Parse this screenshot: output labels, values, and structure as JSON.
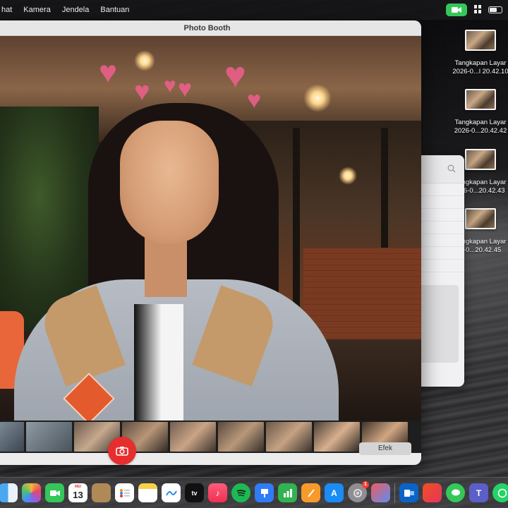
{
  "menubar": {
    "items": [
      "hat",
      "Kamera",
      "Jendela",
      "Bantuan"
    ]
  },
  "window": {
    "title": "Photo Booth"
  },
  "toolbar": {
    "effects_label": "Efek"
  },
  "desktop": {
    "files": [
      {
        "name_line1": "Tangkapan Layar",
        "name_line2": "2026-0...l 20.42.10"
      },
      {
        "name_line1": "Tangkapan Layar",
        "name_line2": "2026-0...20.42.42"
      },
      {
        "name_line1": "Tangkapan Layar",
        "name_line2": "026-0...20.42.43"
      },
      {
        "name_line1": "Tangkapan Layar",
        "name_line2": "6-0...20.42.45"
      }
    ]
  },
  "dock": {
    "calendar_month": "MEI",
    "calendar_day": "13",
    "settings_badge": "1",
    "apps": [
      "finder-icon",
      "photos-icon",
      "facetime-icon",
      "calendar-icon",
      "contacts-icon",
      "reminders-icon",
      "notes-icon",
      "freeform-icon",
      "appletv-icon",
      "music-icon",
      "spotify-icon",
      "keynote-icon",
      "numbers-icon",
      "pages-icon",
      "appstore-icon",
      "system-settings-icon",
      "iphone-mirroring-icon",
      "outlook-icon",
      "office-icon",
      "messages-icon",
      "teams-icon",
      "whatsapp-icon"
    ]
  },
  "colors": {
    "shutter": "#e62e2e",
    "facetime_status": "#34c759"
  }
}
